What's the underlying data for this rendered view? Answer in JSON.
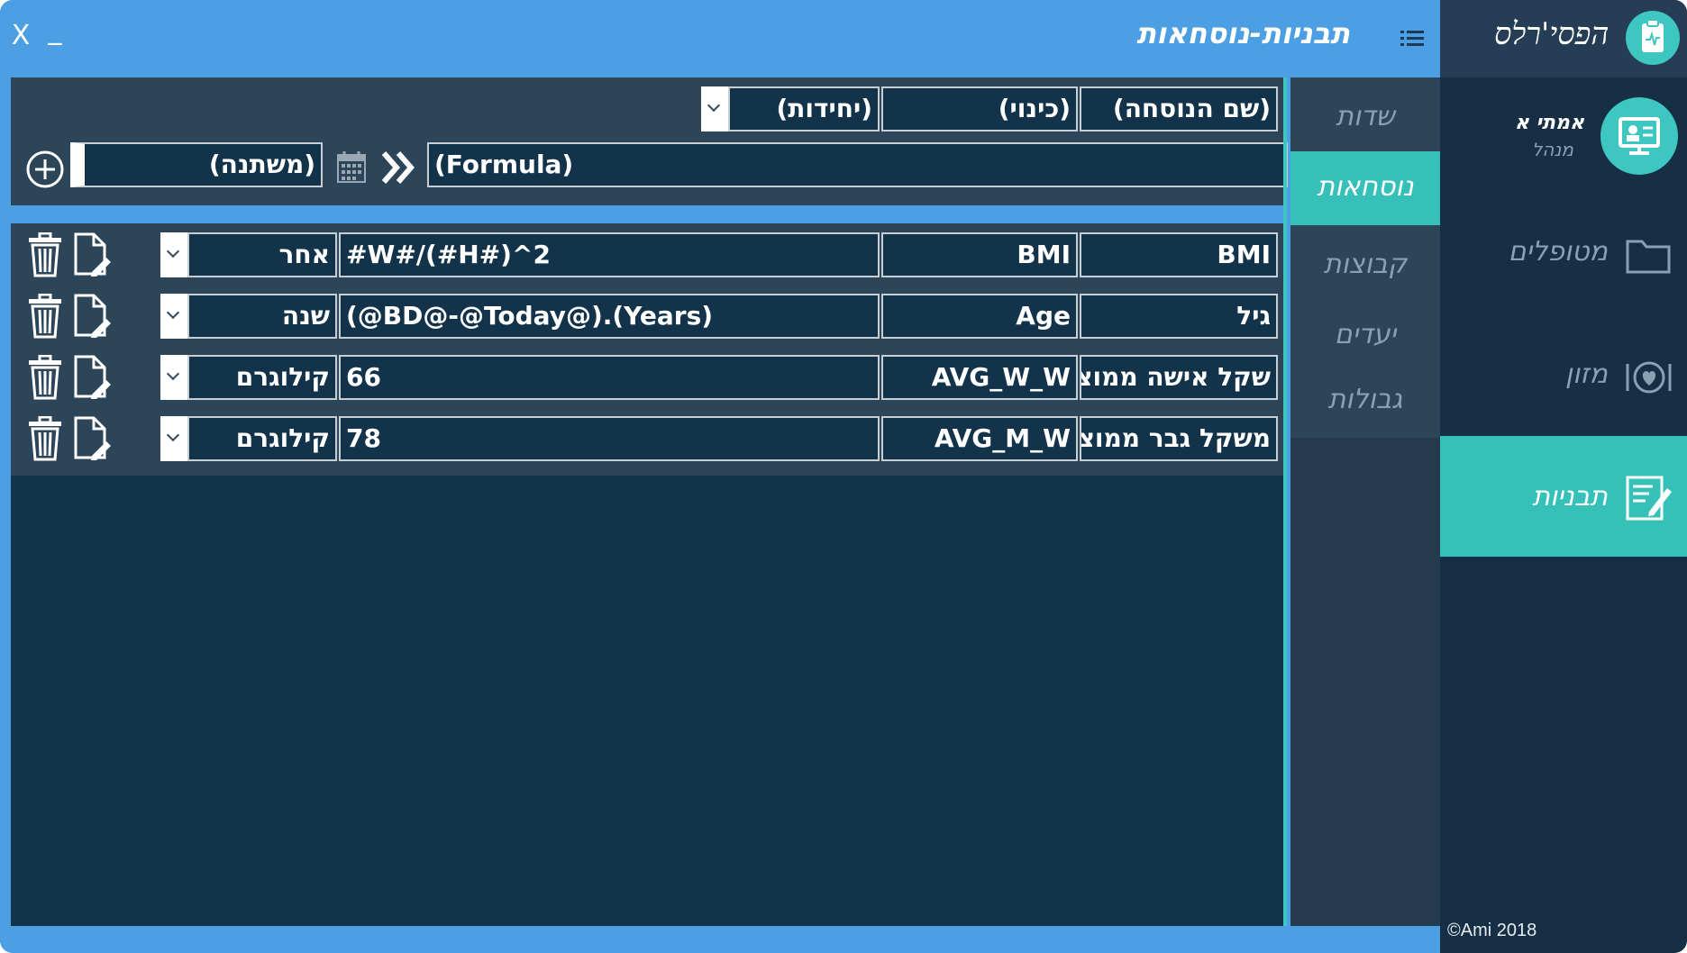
{
  "window": {
    "title": "תבניות-נוסחאות",
    "close_label": "X",
    "minimize_label": "_"
  },
  "sidebar": {
    "logo_text": "הפסי'רלס",
    "user_name": "אמתי א",
    "user_role": "מנהל",
    "items": [
      {
        "label": "מטופלים",
        "icon": "folder-icon",
        "active": false
      },
      {
        "label": "מזון",
        "icon": "plate-heart-icon",
        "active": false
      },
      {
        "label": "תבניות",
        "icon": "template-edit-icon",
        "active": true
      }
    ],
    "copyright": "©Ami 2018"
  },
  "tabs": [
    {
      "label": "שדות",
      "active": false
    },
    {
      "label": "נוסחאות",
      "active": true
    },
    {
      "label": "קבוצות",
      "active": false
    },
    {
      "label": "יעדים",
      "active": false
    },
    {
      "label": "גבולות",
      "active": false
    }
  ],
  "new_formula": {
    "name_placeholder": "(שם הנוסחה)",
    "alias_placeholder": "(כינוי)",
    "units_placeholder": "(יחידות)",
    "formula_placeholder": "(Formula)",
    "variable_placeholder": "(משתנה)"
  },
  "formulas": [
    {
      "name": "BMI",
      "alias": "BMI",
      "formula": "#W#/(#H#)^2",
      "unit": "אחר"
    },
    {
      "name": "גיל",
      "alias": "Age",
      "formula": "(@BD@-@Today@).(Years)",
      "unit": "שנה"
    },
    {
      "name": "שקל אישה ממוצע",
      "alias": "AVG_W_W",
      "formula": "66",
      "unit": "קילוגרם"
    },
    {
      "name": "משקל גבר ממוצע",
      "alias": "AVG_M_W",
      "formula": "78",
      "unit": "קילוגרם"
    }
  ],
  "colors": {
    "title_bar": "#4b9fe2",
    "accent": "#35c1b8",
    "panel": "#2d4558",
    "content_bg": "#12334a"
  }
}
